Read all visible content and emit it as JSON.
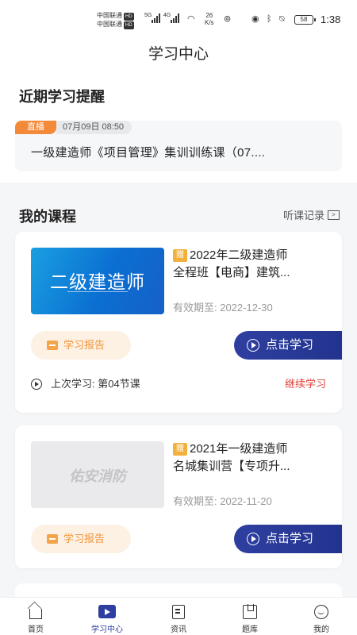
{
  "status_bar": {
    "carrier1": "中国联通",
    "carrier2": "中国联通",
    "hd": "HD",
    "net1": "5G",
    "net2": "4G",
    "speed_value": "26",
    "speed_unit": "K/s",
    "battery": "58",
    "time": "1:38"
  },
  "header": {
    "title": "学习中心"
  },
  "reminders": {
    "section_title": "近期学习提醒",
    "item": {
      "tag": "直播",
      "time": "07月09日 08:50",
      "title": "一级建造师《项目管理》集训训练课（07...."
    }
  },
  "courses": {
    "section_title": "我的课程",
    "history_link": "听课记录",
    "items": [
      {
        "thumbnail_text": "二级建造师",
        "gift_tag": "赠",
        "title_line1": "2022年二级建造师",
        "title_line2": "全程班【电商】建筑...",
        "expire": "有效期至: 2022-12-30",
        "report_label": "学习报告",
        "study_label": "点击学习",
        "last_study": "上次学习: 第04节课",
        "continue_label": "继续学习"
      },
      {
        "thumbnail_text": "佑安消防",
        "gift_tag": "赠",
        "title_line1": "2021年一级建造师",
        "title_line2": "名城集训营【专项升...",
        "expire": "有效期至: 2022-11-20",
        "report_label": "学习报告",
        "study_label": "点击学习"
      }
    ]
  },
  "tabbar": {
    "items": [
      {
        "label": "首页",
        "icon": "home-icon"
      },
      {
        "label": "学习中心",
        "icon": "video-play-icon",
        "active": true
      },
      {
        "label": "资讯",
        "icon": "news-icon"
      },
      {
        "label": "题库",
        "icon": "question-bank-icon"
      },
      {
        "label": "我的",
        "icon": "profile-icon"
      }
    ]
  },
  "colors": {
    "accent_blue": "#2f3fa0",
    "live_orange": "#f28a3a",
    "report_orange": "#f0953a",
    "continue_red": "#e0403a",
    "gift_yellow": "#f3b13c"
  }
}
